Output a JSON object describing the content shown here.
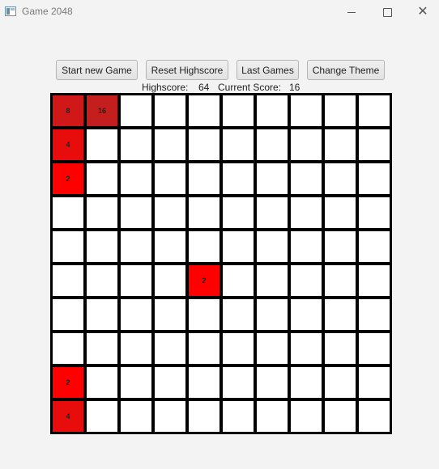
{
  "window": {
    "title": "Game 2048",
    "icon": "app-window-icon"
  },
  "toolbar": {
    "start_label": "Start new Game",
    "reset_label": "Reset Highscore",
    "last_label": "Last Games",
    "theme_label": "Change Theme"
  },
  "scores": {
    "highscore_label": "Highscore:",
    "highscore_value": "64",
    "current_label": "Current Score:",
    "current_value": "16"
  },
  "colors": {
    "tile_2": "#ff0000",
    "tile_4": "#e80c0c",
    "tile_8": "#d01818",
    "tile_16": "#c41e1e",
    "empty": "#ffffff",
    "grid_line": "#000000"
  },
  "board": {
    "size": 10,
    "tiles": [
      {
        "row": 0,
        "col": 0,
        "value": "8"
      },
      {
        "row": 0,
        "col": 1,
        "value": "16"
      },
      {
        "row": 1,
        "col": 0,
        "value": "4"
      },
      {
        "row": 2,
        "col": 0,
        "value": "2"
      },
      {
        "row": 5,
        "col": 4,
        "value": "2"
      },
      {
        "row": 8,
        "col": 0,
        "value": "2"
      },
      {
        "row": 9,
        "col": 0,
        "value": "4"
      }
    ]
  }
}
